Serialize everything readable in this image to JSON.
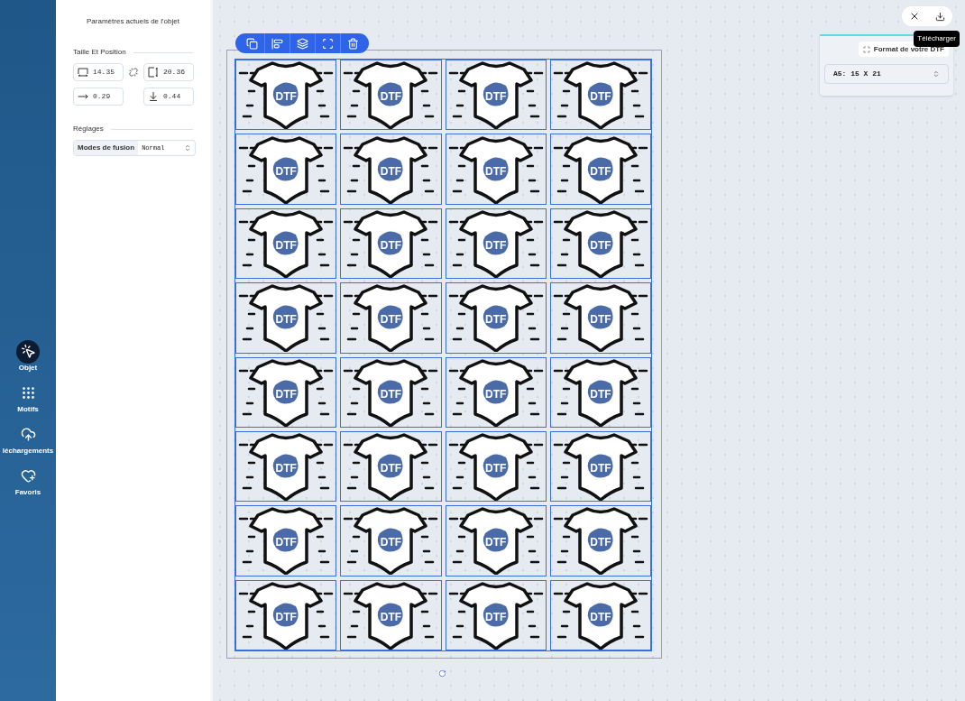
{
  "sidebar": {
    "items": [
      {
        "label": "Objet",
        "selected": true
      },
      {
        "label": "Motifs",
        "selected": false
      },
      {
        "label": "léchargements",
        "selected": false
      },
      {
        "label": "Favoris",
        "selected": false
      }
    ]
  },
  "panel": {
    "title": "Paramètres actuels de l'objet",
    "size_section": {
      "title": "Taille Et Position",
      "fields": [
        {
          "value": "14.35"
        },
        {
          "value": "20.36"
        },
        {
          "value": "0.29"
        },
        {
          "value": "0.44"
        }
      ]
    },
    "settings_section": {
      "title": "Réglages",
      "blend_label": "Modes de fusion",
      "blend_value": "Normal"
    }
  },
  "tiles": [
    "DTF",
    "DTF",
    "DTF",
    "DTF",
    "DTF",
    "DTF",
    "DTF",
    "DTF",
    "DTF",
    "DTF",
    "DTF",
    "DTF",
    "DTF",
    "DTF",
    "DTF",
    "DTF",
    "DTF",
    "DTF",
    "DTF",
    "DTF",
    "DTF",
    "DTF",
    "DTF",
    "DTF",
    "DTF",
    "DTF",
    "DTF",
    "DTF",
    "DTF",
    "DTF",
    "DTF",
    "DTF"
  ],
  "format_panel": {
    "button": "Format de votre DTF",
    "select_value": "A5: 15 X 21"
  },
  "tooltip": "Télécharger"
}
